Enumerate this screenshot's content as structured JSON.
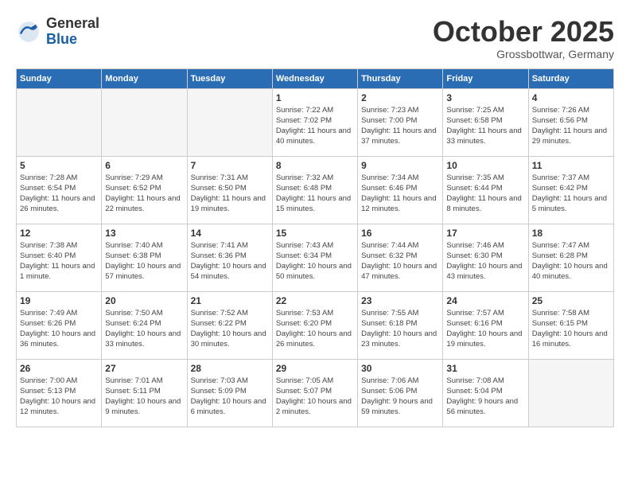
{
  "header": {
    "logo_general": "General",
    "logo_blue": "Blue",
    "month_title": "October 2025",
    "subtitle": "Grossbottwar, Germany"
  },
  "days_of_week": [
    "Sunday",
    "Monday",
    "Tuesday",
    "Wednesday",
    "Thursday",
    "Friday",
    "Saturday"
  ],
  "weeks": [
    [
      {
        "day": "",
        "info": ""
      },
      {
        "day": "",
        "info": ""
      },
      {
        "day": "",
        "info": ""
      },
      {
        "day": "1",
        "info": "Sunrise: 7:22 AM\nSunset: 7:02 PM\nDaylight: 11 hours and 40 minutes."
      },
      {
        "day": "2",
        "info": "Sunrise: 7:23 AM\nSunset: 7:00 PM\nDaylight: 11 hours and 37 minutes."
      },
      {
        "day": "3",
        "info": "Sunrise: 7:25 AM\nSunset: 6:58 PM\nDaylight: 11 hours and 33 minutes."
      },
      {
        "day": "4",
        "info": "Sunrise: 7:26 AM\nSunset: 6:56 PM\nDaylight: 11 hours and 29 minutes."
      }
    ],
    [
      {
        "day": "5",
        "info": "Sunrise: 7:28 AM\nSunset: 6:54 PM\nDaylight: 11 hours and 26 minutes."
      },
      {
        "day": "6",
        "info": "Sunrise: 7:29 AM\nSunset: 6:52 PM\nDaylight: 11 hours and 22 minutes."
      },
      {
        "day": "7",
        "info": "Sunrise: 7:31 AM\nSunset: 6:50 PM\nDaylight: 11 hours and 19 minutes."
      },
      {
        "day": "8",
        "info": "Sunrise: 7:32 AM\nSunset: 6:48 PM\nDaylight: 11 hours and 15 minutes."
      },
      {
        "day": "9",
        "info": "Sunrise: 7:34 AM\nSunset: 6:46 PM\nDaylight: 11 hours and 12 minutes."
      },
      {
        "day": "10",
        "info": "Sunrise: 7:35 AM\nSunset: 6:44 PM\nDaylight: 11 hours and 8 minutes."
      },
      {
        "day": "11",
        "info": "Sunrise: 7:37 AM\nSunset: 6:42 PM\nDaylight: 11 hours and 5 minutes."
      }
    ],
    [
      {
        "day": "12",
        "info": "Sunrise: 7:38 AM\nSunset: 6:40 PM\nDaylight: 11 hours and 1 minute."
      },
      {
        "day": "13",
        "info": "Sunrise: 7:40 AM\nSunset: 6:38 PM\nDaylight: 10 hours and 57 minutes."
      },
      {
        "day": "14",
        "info": "Sunrise: 7:41 AM\nSunset: 6:36 PM\nDaylight: 10 hours and 54 minutes."
      },
      {
        "day": "15",
        "info": "Sunrise: 7:43 AM\nSunset: 6:34 PM\nDaylight: 10 hours and 50 minutes."
      },
      {
        "day": "16",
        "info": "Sunrise: 7:44 AM\nSunset: 6:32 PM\nDaylight: 10 hours and 47 minutes."
      },
      {
        "day": "17",
        "info": "Sunrise: 7:46 AM\nSunset: 6:30 PM\nDaylight: 10 hours and 43 minutes."
      },
      {
        "day": "18",
        "info": "Sunrise: 7:47 AM\nSunset: 6:28 PM\nDaylight: 10 hours and 40 minutes."
      }
    ],
    [
      {
        "day": "19",
        "info": "Sunrise: 7:49 AM\nSunset: 6:26 PM\nDaylight: 10 hours and 36 minutes."
      },
      {
        "day": "20",
        "info": "Sunrise: 7:50 AM\nSunset: 6:24 PM\nDaylight: 10 hours and 33 minutes."
      },
      {
        "day": "21",
        "info": "Sunrise: 7:52 AM\nSunset: 6:22 PM\nDaylight: 10 hours and 30 minutes."
      },
      {
        "day": "22",
        "info": "Sunrise: 7:53 AM\nSunset: 6:20 PM\nDaylight: 10 hours and 26 minutes."
      },
      {
        "day": "23",
        "info": "Sunrise: 7:55 AM\nSunset: 6:18 PM\nDaylight: 10 hours and 23 minutes."
      },
      {
        "day": "24",
        "info": "Sunrise: 7:57 AM\nSunset: 6:16 PM\nDaylight: 10 hours and 19 minutes."
      },
      {
        "day": "25",
        "info": "Sunrise: 7:58 AM\nSunset: 6:15 PM\nDaylight: 10 hours and 16 minutes."
      }
    ],
    [
      {
        "day": "26",
        "info": "Sunrise: 7:00 AM\nSunset: 5:13 PM\nDaylight: 10 hours and 12 minutes."
      },
      {
        "day": "27",
        "info": "Sunrise: 7:01 AM\nSunset: 5:11 PM\nDaylight: 10 hours and 9 minutes."
      },
      {
        "day": "28",
        "info": "Sunrise: 7:03 AM\nSunset: 5:09 PM\nDaylight: 10 hours and 6 minutes."
      },
      {
        "day": "29",
        "info": "Sunrise: 7:05 AM\nSunset: 5:07 PM\nDaylight: 10 hours and 2 minutes."
      },
      {
        "day": "30",
        "info": "Sunrise: 7:06 AM\nSunset: 5:06 PM\nDaylight: 9 hours and 59 minutes."
      },
      {
        "day": "31",
        "info": "Sunrise: 7:08 AM\nSunset: 5:04 PM\nDaylight: 9 hours and 56 minutes."
      },
      {
        "day": "",
        "info": ""
      }
    ]
  ]
}
